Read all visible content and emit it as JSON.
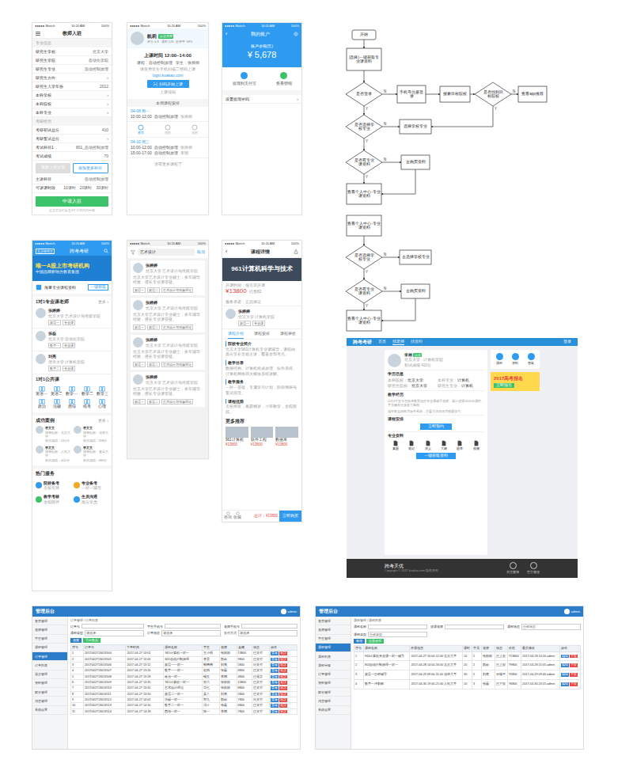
{
  "status_bar": {
    "carrier": "●●●●● Sketch",
    "time": "10:20 AM",
    "battery": "100%"
  },
  "form": {
    "title": "教师入驻",
    "sections": [
      {
        "title": "专业信息",
        "rows": [
          {
            "label": "研究生学校",
            "value": "北京大学"
          },
          {
            "label": "研究生学院",
            "value": "自动化学院"
          },
          {
            "label": "研究生专业",
            "value": "自动控制原理"
          },
          {
            "label": "研究生方向",
            "value": "›"
          },
          {
            "label": "研究生入学年份",
            "value": "2012"
          },
          {
            "label": "本科学校",
            "value": "›"
          },
          {
            "label": "本科院校",
            "value": "›"
          },
          {
            "label": "本科专业",
            "value": "›"
          }
        ]
      },
      {
        "title": "考研经历",
        "rows": [
          {
            "label": "考研初试总分",
            "value": "410"
          },
          {
            "label": "考研复试总分",
            "value": "›"
          },
          {
            "label": "考试科目1",
            "value": "801_自动控制原理"
          },
          {
            "label": "考试成绩",
            "value": "70"
          }
        ]
      }
    ],
    "upload_buttons": [
      "重新上传证明",
      "添加更多科目"
    ],
    "rows2": [
      {
        "label": "主讲科目",
        "value": "自动控制原理"
      },
      {
        "label": "可讲课时段",
        "value": "10课时、20课时、30课时"
      }
    ],
    "submit": "申请入驻",
    "footnote": "提交后我们会在3个工作日内审核"
  },
  "home": {
    "name": "凯莉",
    "badge": "认证讲师",
    "stats": [
      "评分 4.8",
      "课时 128",
      "好评率 98%"
    ],
    "card": {
      "time": "上课时间 12:00~14:00",
      "course": "课程：自动控制原理",
      "student": "学生：张师师",
      "hint": "请使用学生手机扫描二维码上课",
      "link": "login.kuakao.com",
      "button": "扫码开始上课",
      "sub": "上课须知"
    },
    "schedule_title": "本周课程安排",
    "days": [
      {
        "date": "04-08 周一",
        "items": [
          {
            "time": "10:00-12:00",
            "course": "自动控制原理",
            "student": "张师师"
          }
        ]
      },
      {
        "date": "04-10 周三",
        "items": [
          {
            "time": "10:00-12:00",
            "course": "自动控制原理",
            "student": "张师师"
          },
          {
            "time": "15:00-17:00",
            "course": "自动控制原理",
            "student": "李明"
          }
        ]
      }
    ],
    "tabs": [
      {
        "label": "首页",
        "selected": true
      },
      {
        "label": "消息",
        "selected": false
      },
      {
        "label": "我的",
        "selected": false
      }
    ],
    "more": "没有更多课程了"
  },
  "wallet": {
    "back": "‹",
    "title": "我的账户",
    "balance_label": "账户余额(元)",
    "balance": "¥ 5,678",
    "actions": [
      {
        "label": "提现到支付宝",
        "color": "#2e9bf0"
      },
      {
        "label": "查看明细",
        "color": "#3cc36a"
      }
    ],
    "menu": [
      "设置提现密码"
    ],
    "chevron": "›"
  },
  "portal": {
    "city": "北京研究生",
    "title": "跨考考研",
    "banner_title": "唯一A股上市考研机构",
    "banner_sub": "中国品牌影响力教育集团",
    "materials": {
      "label": "海量专业课程资料",
      "button": "一键获取"
    },
    "teachers_title": "1对1专业课老师",
    "more": "更多 ›",
    "teachers": [
      {
        "name": "张婷婷",
        "school": "北京大学",
        "dept": "艺术设计与传媒学院",
        "tags": [
          "英语一",
          "专业课"
        ]
      },
      {
        "name": "张磊",
        "school": "北京大学",
        "dept": "自动化学院",
        "tags": [
          "数学一",
          "专业课"
        ]
      },
      {
        "name": "刘亮",
        "school": "清华大学",
        "dept": "计算机学院",
        "tags": [
          "数学二",
          "专业课"
        ]
      }
    ],
    "grid_title": "1对1公共课",
    "grid": [
      "英语一",
      "英语二",
      "数学一",
      "数学二",
      "数学三",
      "政治",
      "法硕",
      "西综",
      "统考",
      "心理"
    ],
    "cases_title": "成功案例",
    "cases": [
      {
        "name": "李文文",
        "lines": [
          "报考院校：北京大学",
          "初试成绩：410分"
        ]
      },
      {
        "name": "李文文",
        "lines": [
          "报考院校：清华大学",
          "初试成绩：398分"
        ]
      },
      {
        "name": "李文文",
        "lines": [
          "报考院校：人民大学",
          "初试成绩：402分"
        ]
      },
      {
        "name": "李文文",
        "lines": [
          "报考院校：复旦大学",
          "初试成绩：389分"
        ]
      }
    ],
    "services_title": "热门服务",
    "services": [
      {
        "title": "院校备考",
        "sub": "名校名师",
        "color": "#2e9bf0"
      },
      {
        "title": "专业备考",
        "sub": "一对一辅导",
        "color": "#f5a623"
      },
      {
        "title": "教学考核",
        "sub": "全程陪伴",
        "color": "#3cc36a"
      },
      {
        "title": "生员沟通",
        "sub": "高分学员",
        "color": "#2e9bf0"
      }
    ]
  },
  "search": {
    "query": "艺术设计",
    "cancel": "取消",
    "cards": [
      {
        "name": "张婷婷",
        "school": "北京大学  艺术设计与传媒学院",
        "desc": "北京大学艺术设计专业硕士，多年辅导经验，擅长专业课答疑。",
        "tags": [
          "英语一",
          "英语二",
          "艺术设计与传媒理论"
        ]
      },
      {
        "name": "张婷婷",
        "school": "北京大学  艺术设计与传媒学院",
        "desc": "北京大学艺术设计专业硕士，多年辅导经验，擅长专业课答疑。",
        "tags": [
          "英语一",
          "英语二",
          "艺术设计与传媒理论"
        ]
      },
      {
        "name": "张婷婷",
        "school": "北京大学  艺术设计与传媒学院",
        "desc": "北京大学艺术设计专业硕士，多年辅导经验，擅长专业课答疑。",
        "tags": [
          "英语一",
          "英语二",
          "艺术设计与传媒理论"
        ]
      },
      {
        "name": "张婷婷",
        "school": "北京大学  艺术设计与传媒学院",
        "desc": "北京大学艺术设计专业硕士，多年辅导经验，擅长专业课答疑。",
        "tags": [
          "英语一",
          "英语二",
          "艺术设计与传媒理论"
        ]
      }
    ]
  },
  "course": {
    "back": "‹",
    "title": "课程详情",
    "banner": "961计算机科学与技术",
    "meta": "开课时间：报名后开课",
    "price": "¥13800",
    "sold": "已售82",
    "service": "服务承诺：正品保证",
    "teacher": {
      "name": "张婷婷",
      "school": "北京大学  计算机学院",
      "tags": [
        "英语一",
        "专业课"
      ]
    },
    "tabs": [
      {
        "label": "课程介绍",
        "selected": true
      },
      {
        "label": "课程安排",
        "selected": false
      },
      {
        "label": "课程评价",
        "selected": false
      }
    ],
    "sections": [
      {
        "title": "院校专业简介",
        "text": "北京大学961计算机专业课辅导，课程由高分学长学姐主讲，覆盖全部考点。"
      },
      {
        "title": "教学目录",
        "text": "数据结构、计算机组成原理、操作系统、计算机网络四大模块系统讲解。"
      },
      {
        "title": "教学服务",
        "text": "一对一答疑，专属学习计划，阶段测评与复试指导。"
      },
      {
        "title": "课程优势",
        "text": "名校师资，真题精讲，小班教学，全程跟踪。"
      }
    ],
    "more_title": "更多推荐",
    "recs": [
      {
        "name": "961计算机",
        "price": "¥13800"
      },
      {
        "name": "软件工程",
        "price": "¥13800"
      },
      {
        "name": "数据库",
        "price": "¥13800"
      }
    ],
    "bottom": [
      "咨询",
      "收藏"
    ],
    "total": "总计：¥13800",
    "buy": "立即购买"
  },
  "flow": {
    "nodes": [
      {
        "text": "开始",
        "kind": "terminal"
      },
      {
        "text": "(选择)一键获取专业课资料",
        "kind": "process"
      },
      {
        "text": "是否登录",
        "kind": "decision"
      },
      {
        "text": "手机号注册登录",
        "kind": "process"
      },
      {
        "text": "搜索目标院校",
        "kind": "process"
      },
      {
        "text": "是否找到目标院校",
        "kind": "decision"
      },
      {
        "text": "查看app推荐",
        "kind": "process"
      },
      {
        "text": "是否选择学校专业",
        "kind": "decision"
      },
      {
        "text": "选择学校专业",
        "kind": "process"
      },
      {
        "text": "是否有专业课资料",
        "kind": "decision"
      },
      {
        "text": "去购买资料",
        "kind": "process"
      },
      {
        "text": "查看个人中心-专业课资料",
        "kind": "process"
      },
      {
        "text": "查看个人中心-专业课资料",
        "kind": "process"
      },
      {
        "text": "是否选择学校专业",
        "kind": "decision"
      },
      {
        "text": "去选择学校专业",
        "kind": "process"
      },
      {
        "text": "是否有专业课资料",
        "kind": "decision"
      },
      {
        "text": "去购买资料",
        "kind": "process"
      },
      {
        "text": "查看个人中心-专业课资料",
        "kind": "process"
      }
    ],
    "edges": [
      {
        "from": 0,
        "to": 1,
        "label": ""
      },
      {
        "from": 1,
        "to": 2,
        "label": ""
      },
      {
        "from": 2,
        "to": 3,
        "label": "N"
      },
      {
        "from": 3,
        "to": 4,
        "label": ""
      },
      {
        "from": 4,
        "to": 5,
        "label": ""
      },
      {
        "from": 5,
        "to": 6,
        "label": "N"
      },
      {
        "from": 5,
        "to": 8,
        "label": "Y"
      },
      {
        "from": 2,
        "to": 7,
        "label": "Y"
      },
      {
        "from": 7,
        "to": 8,
        "label": "N"
      },
      {
        "from": 7,
        "to": 9,
        "label": "Y"
      },
      {
        "from": 9,
        "to": 10,
        "label": "N"
      },
      {
        "from": 9,
        "to": 11,
        "label": "Y"
      },
      {
        "from": 10,
        "to": 11,
        "label": ""
      },
      {
        "from": 12,
        "to": 13,
        "label": ""
      },
      {
        "from": 13,
        "to": 14,
        "label": "N"
      },
      {
        "from": 13,
        "to": 15,
        "label": "Y"
      },
      {
        "from": 15,
        "to": 16,
        "label": "N"
      },
      {
        "from": 15,
        "to": 17,
        "label": "Y"
      },
      {
        "from": 16,
        "to": 17,
        "label": ""
      }
    ]
  },
  "web": {
    "logo": "跨考考研",
    "nav": [
      {
        "label": "首页",
        "selected": false
      },
      {
        "label": "找老师",
        "selected": true
      },
      {
        "label": "找资料",
        "selected": false
      }
    ],
    "login": "登录",
    "profile": {
      "name": "李桐",
      "badge": "认证",
      "lines": [
        "北京大学 · 计算机学院",
        "初试成绩 410分"
      ]
    },
    "info_title": "学历信息",
    "info": [
      [
        "本科院校",
        "北京大学"
      ],
      [
        "本科专业",
        "计算机"
      ],
      [
        "研究生院校",
        "北京大学"
      ],
      [
        "研究生专业",
        "计算机"
      ]
    ],
    "exp_title": "教学经历",
    "exp": [
      "2013年至今在跨考教育担任专业课辅导老师，累计授课1000余课时，学员遍布全国各大高校。",
      "擅长数据结构与操作系统，注重方法总结与答题技巧。"
    ],
    "courses_title": "课程安排",
    "course_button": "立即预约",
    "files_title": "专业资料",
    "files": [
      "真题",
      "笔记",
      "讲义",
      "大纲",
      "题库",
      "视频"
    ],
    "files_button": "一键获取资料",
    "icons": [
      "课程",
      "资料",
      "答疑"
    ],
    "promo": "2017高考报名",
    "promo_button": "立即报名",
    "footer": "跨考天优",
    "footer_links": [
      "关注微博",
      "官方微信"
    ],
    "copyright": "Copyright © 2017 kuakao.com 版权所有"
  },
  "admin1": {
    "logo": "管理后台",
    "user": "admin",
    "crumb": "订单管理 / 订单列表",
    "menu": [
      {
        "label": "首页管理",
        "selected": false
      },
      {
        "label": "老师管理",
        "selected": false
      },
      {
        "label": "学生管理",
        "selected": false
      },
      {
        "label": "课程管理",
        "selected": false
      },
      {
        "label": "订单管理",
        "selected": true
      },
      {
        "label": "订单列表",
        "selected": false
      },
      {
        "label": "退款管理",
        "selected": false
      },
      {
        "label": "资料管理",
        "selected": false
      },
      {
        "label": "财务管理",
        "selected": false
      },
      {
        "label": "消息管理",
        "selected": false
      },
      {
        "label": "系统设置",
        "selected": false
      }
    ],
    "filters": [
      [
        "订单号",
        ""
      ],
      [
        "学生手机号",
        ""
      ],
      [
        "老师手机号",
        ""
      ],
      [
        "课程类型",
        "请选择"
      ],
      [
        "订单状态",
        "请选择"
      ],
      [
        "支付方式",
        "请选择"
      ]
    ],
    "buttons": [
      "搜索",
      "导出数据"
    ],
    "columns": [
      "序号",
      "订单号",
      "下单时间",
      "课程名称",
      "学生",
      "老师",
      "金额",
      "状态",
      "操作"
    ],
    "rows": [
      [
        "1",
        "2017042713013504",
        "2017-04-27 13:01",
        "961计算机一对一",
        "王小明",
        "张婷婷",
        "13800",
        "已支付"
      ],
      [
        "2",
        "2017042713013505",
        "2017-04-27 13:05",
        "801自动控制原理",
        "李雷",
        "凯莉",
        "9800",
        "已支付"
      ],
      [
        "3",
        "2017042713013506",
        "2017-04-27 13:12",
        "英语一一对一",
        "韩梅梅",
        "刘亮",
        "5800",
        "待支付"
      ],
      [
        "4",
        "2017042713013507",
        "2017-04-27 13:20",
        "数学一一对一",
        "赵四",
        "张磊",
        "6800",
        "已支付"
      ],
      [
        "5",
        "2017042713013508",
        "2017-04-27 13:28",
        "政治一对一",
        "钱五",
        "李桐",
        "4800",
        "已退款"
      ],
      [
        "6",
        "2017042713013509",
        "2017-04-27 13:35",
        "961计算机一对一",
        "孙六",
        "张婷婷",
        "13800",
        "已支付"
      ],
      [
        "7",
        "2017042713013510",
        "2017-04-27 13:41",
        "艺术设计理论",
        "周七",
        "张婷婷",
        "8800",
        "已支付"
      ],
      [
        "8",
        "2017042713013511",
        "2017-04-27 13:50",
        "英语二一对一",
        "吴八",
        "刘亮",
        "5800",
        "已支付"
      ],
      [
        "9",
        "2017042713013512",
        "2017-04-27 14:02",
        "法硕一对一",
        "郑九",
        "凯莉",
        "7800",
        "待支付"
      ],
      [
        "10",
        "2017042713013513",
        "2017-04-27 14:10",
        "数学二一对一",
        "冯十",
        "张磊",
        "6800",
        "已支付"
      ],
      [
        "11",
        "2017042713013514",
        "2017-04-27 14:18",
        "西综一对一",
        "陈一",
        "李桐",
        "7800",
        "已支付"
      ]
    ],
    "ops": [
      "查看",
      "退款"
    ]
  },
  "admin2": {
    "logo": "管理后台",
    "user": "admin",
    "crumb": "课程管理 / 课程列表",
    "menu": [
      {
        "label": "首页管理",
        "selected": false
      },
      {
        "label": "老师管理",
        "selected": false
      },
      {
        "label": "学生管理",
        "selected": false
      },
      {
        "label": "课程管理",
        "selected": true
      },
      {
        "label": "课程列表",
        "selected": false
      },
      {
        "label": "课程审核",
        "selected": false
      },
      {
        "label": "订单管理",
        "selected": false
      },
      {
        "label": "资料管理",
        "selected": false
      },
      {
        "label": "财务管理",
        "selected": false
      },
      {
        "label": "消息管理",
        "selected": false
      },
      {
        "label": "系统设置",
        "selected": false
      }
    ],
    "filters": [
      [
        "课程名称",
        ""
      ],
      [
        "授课老师",
        ""
      ],
      [
        "课程状态",
        "全部状态"
      ],
      [
        "课程类型",
        "全部类型"
      ]
    ],
    "buttons": [
      "新增",
      "批量操作"
    ],
    "columns": [
      "序号",
      "课程名称",
      "开课信息",
      "课时",
      "学员",
      "老师",
      "状态",
      "价格",
      "最后修改",
      "操作"
    ],
    "rows": [
      [
        "1",
        "961计算机专业课一对一辅导",
        "2017-04-27 10:00-12:00 北京大学",
        "10",
        "1",
        "张婷婷",
        "已上架",
        "¥13800",
        "2017-04-28 10:20 admin"
      ],
      [
        "2",
        "801自动控制原理一对一",
        "2017-04-28 14:00-16:00 北京大学",
        "20",
        "2",
        "凯莉",
        "已上架",
        "¥9800",
        "2017-04-28 11:05 admin"
      ],
      [
        "3",
        "英语一全程辅导",
        "2017-04-29 09:00-11:00 清华大学",
        "30",
        "5",
        "刘亮",
        "审核中",
        "¥5800",
        "2017-04-29 09:40 admin"
      ],
      [
        "4",
        "数学一冲刺班",
        "2017-04-30 19:00-21:00 人民大学",
        "10",
        "3",
        "张磊",
        "已下架",
        "¥6800",
        "2017-04-30 20:15 admin"
      ]
    ],
    "ops": [
      "编辑",
      "下架"
    ]
  }
}
